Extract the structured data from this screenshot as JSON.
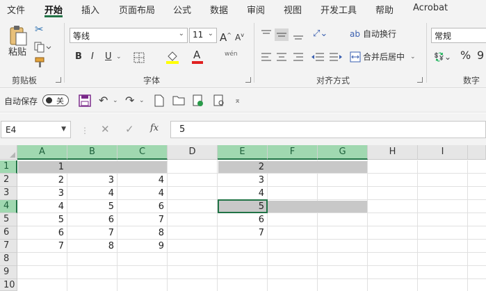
{
  "ribbon_tabs": [
    "文件",
    "开始",
    "插入",
    "页面布局",
    "公式",
    "数据",
    "审阅",
    "视图",
    "开发工具",
    "帮助",
    "Acrobat"
  ],
  "active_tab": "开始",
  "clipboard": {
    "paste_label": "粘贴",
    "group_label": "剪贴板"
  },
  "font": {
    "name": "等线",
    "size": "11",
    "group_label": "字体",
    "bold": "B",
    "italic": "I",
    "underline": "U",
    "grow": "A",
    "shrink": "A",
    "color_letter": "A",
    "pinyin": "wén"
  },
  "alignment": {
    "wrap_label": "自动换行",
    "merge_label": "合并后居中",
    "group_label": "对齐方式"
  },
  "number": {
    "format": "常规",
    "group_label": "数字",
    "percent": "%",
    "comma": "9"
  },
  "qat": {
    "autosave_label": "自动保存",
    "autosave_state": "关"
  },
  "formula_bar": {
    "name_box": "E4",
    "fx": "fx",
    "content": "5",
    "cancel": "✕",
    "enter": "✓",
    "sep": "⋮"
  },
  "columns": [
    "A",
    "B",
    "C",
    "D",
    "E",
    "F",
    "G",
    "H",
    "I"
  ],
  "rows": [
    "1",
    "2",
    "3",
    "4",
    "5",
    "6",
    "7",
    "8",
    "9",
    "10"
  ],
  "cells": {
    "A": [
      "1",
      "2",
      "3",
      "4",
      "5",
      "6",
      "7",
      "",
      "",
      ""
    ],
    "B": [
      "",
      "3",
      "4",
      "5",
      "6",
      "7",
      "8",
      "",
      "",
      ""
    ],
    "C": [
      "",
      "4",
      "4",
      "6",
      "7",
      "8",
      "9",
      "",
      "",
      ""
    ],
    "E": [
      "2",
      "3",
      "4",
      "5",
      "6",
      "7",
      "",
      "",
      "",
      ""
    ]
  },
  "selected_cell": "E4",
  "colors": {
    "accent": "#217346",
    "header_selected": "#a0d8b0",
    "shade": "#c8c8c8",
    "ribbon_bg": "#f3f3f3"
  }
}
